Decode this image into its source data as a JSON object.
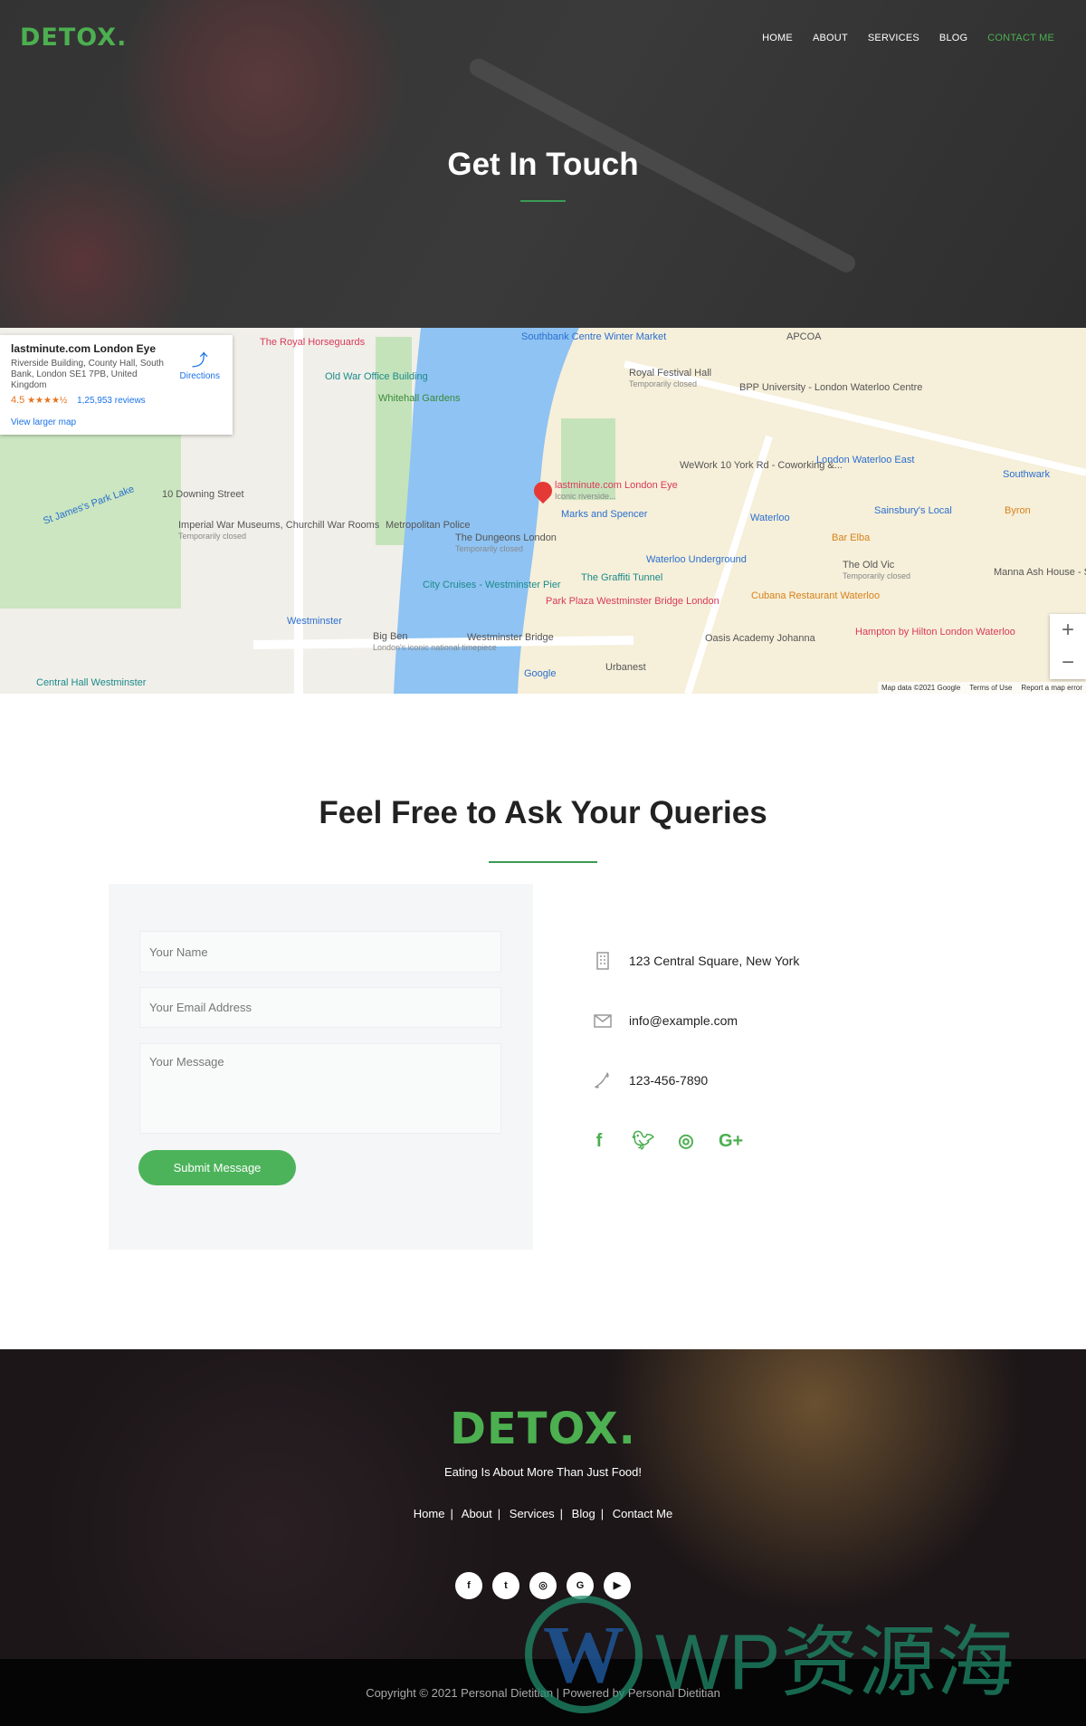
{
  "header": {
    "logo": "DETOX.",
    "nav": [
      {
        "label": "HOME"
      },
      {
        "label": "ABOUT"
      },
      {
        "label": "SERVICES"
      },
      {
        "label": "BLOG"
      },
      {
        "label": "CONTACT ME",
        "active": true
      }
    ]
  },
  "hero": {
    "title": "Get In Touch"
  },
  "map": {
    "card": {
      "title": "lastminute.com London Eye",
      "address": "Riverside Building, County Hall, South Bank, London SE1 7PB, United Kingdom",
      "rating": "4.5",
      "stars": "★★★★½",
      "reviews": "1,25,953 reviews",
      "directions": "Directions",
      "larger": "View larger map"
    },
    "labels": [
      {
        "text": "The Royal Horseguards",
        "c": "r"
      },
      {
        "text": "Old War Office Building",
        "c": "t"
      },
      {
        "text": "Whitehall Gardens",
        "c": "gr"
      },
      {
        "text": "Southbank Centre Winter Market",
        "c": "b"
      },
      {
        "text": "Royal Festival Hall",
        "sub": "Temporarily closed",
        "c": "g"
      },
      {
        "text": "BPP University - London Waterloo Centre",
        "c": "g"
      },
      {
        "text": "APCOA",
        "c": "g"
      },
      {
        "text": "10 Downing Street",
        "c": "g"
      },
      {
        "text": "Imperial War Museums, Churchill War Rooms",
        "sub": "Temporarily closed",
        "c": "g"
      },
      {
        "text": "St James's Park Lake",
        "c": "b"
      },
      {
        "text": "Metropolitan Police",
        "c": "g"
      },
      {
        "text": "lastminute.com London Eye",
        "sub": "Iconic riverside...",
        "c": "r"
      },
      {
        "text": "Marks and Spencer",
        "c": "b"
      },
      {
        "text": "WeWork 10 York Rd - Coworking &...",
        "c": "g"
      },
      {
        "text": "The Dungeons London",
        "sub": "Temporarily closed",
        "c": "g"
      },
      {
        "text": "London Waterloo East",
        "c": "b"
      },
      {
        "text": "Southwark",
        "c": "b"
      },
      {
        "text": "Sainsbury's Local",
        "c": "b"
      },
      {
        "text": "Byron",
        "c": "o"
      },
      {
        "text": "Waterloo",
        "c": "b"
      },
      {
        "text": "Bar Elba",
        "c": "o"
      },
      {
        "text": "Waterloo Underground",
        "c": "b"
      },
      {
        "text": "The Old Vic",
        "sub": "Temporarily closed",
        "c": "g"
      },
      {
        "text": "Manna Ash House - Sanctuary Students",
        "c": "g"
      },
      {
        "text": "The Graffiti Tunnel",
        "c": "t"
      },
      {
        "text": "City Cruises - Westminster Pier",
        "c": "t"
      },
      {
        "text": "Park Plaza Westminster Bridge London",
        "c": "r"
      },
      {
        "text": "Cubana Restaurant Waterloo",
        "c": "o"
      },
      {
        "text": "Westminster",
        "c": "b"
      },
      {
        "text": "Big Ben",
        "sub": "London's iconic national timepiece",
        "c": "g"
      },
      {
        "text": "Westminster Bridge",
        "c": "g"
      },
      {
        "text": "Oasis Academy Johanna",
        "c": "g"
      },
      {
        "text": "Hampton by Hilton London Waterloo",
        "c": "r"
      },
      {
        "text": "Urbanest",
        "c": "g"
      },
      {
        "text": "Central Hall Westminster",
        "c": "t"
      },
      {
        "text": "Google",
        "c": "b"
      }
    ],
    "footer": {
      "data": "Map data ©2021 Google",
      "terms": "Terms of Use",
      "report": "Report a map error"
    },
    "zoom_in": "+",
    "zoom_out": "−"
  },
  "contact": {
    "heading": "Feel Free to Ask Your Queries",
    "form": {
      "name_placeholder": "Your Name",
      "email_placeholder": "Your Email Address",
      "message_placeholder": "Your Message",
      "submit": "Submit Message"
    },
    "info": {
      "address": "123 Central Square, New York",
      "email": "info@example.com",
      "phone": "123-456-7890"
    },
    "social": [
      "facebook-icon",
      "twitter-icon",
      "instagram-icon",
      "google-plus-icon"
    ],
    "accent": "#4caf50"
  },
  "footer": {
    "logo": "DETOX.",
    "tagline": "Eating Is About More Than Just Food!",
    "links": [
      "Home",
      "About",
      "Services",
      "Blog",
      "Contact Me"
    ],
    "social": [
      "facebook-icon",
      "twitter-icon",
      "instagram-icon",
      "google-icon",
      "youtube-icon"
    ],
    "copyright": "Copyright © 2021 Personal Dietitian | Powered by Personal Dietitian"
  },
  "watermark": {
    "text": "WP资源海"
  }
}
